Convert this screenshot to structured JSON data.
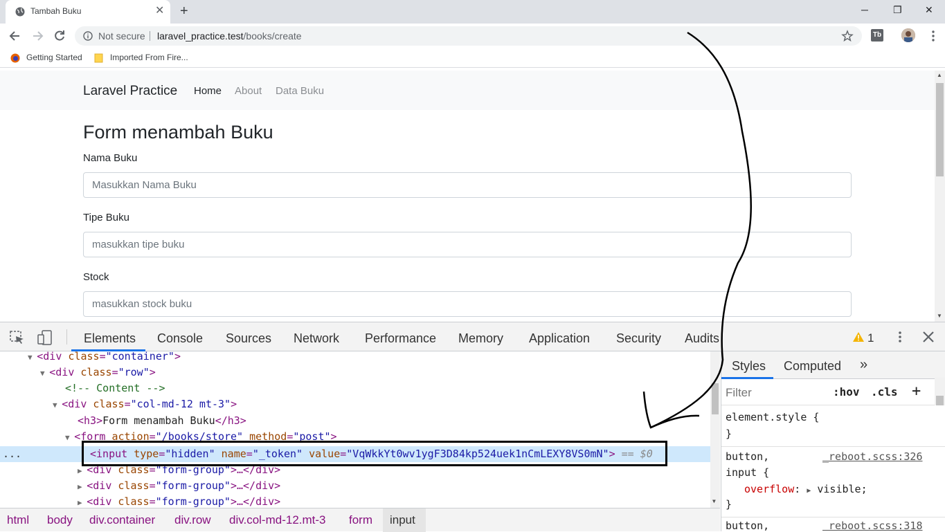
{
  "browser": {
    "tab_title": "Tambah Buku",
    "not_secure_label": "Not secure",
    "url_host": "laravel_practice.test",
    "url_path": "/books/create",
    "bookmarks": [
      {
        "label": "Getting Started"
      },
      {
        "label": "Imported From Fire..."
      }
    ]
  },
  "page": {
    "brand": "Laravel Practice",
    "nav": [
      "Home",
      "About",
      "Data Buku"
    ],
    "title": "Form menambah Buku",
    "fields": [
      {
        "label": "Nama Buku",
        "placeholder": "Masukkan Nama Buku",
        "value": ""
      },
      {
        "label": "Tipe Buku",
        "placeholder": "masukkan tipe buku",
        "value": ""
      },
      {
        "label": "Stock",
        "placeholder": "masukkan stock buku",
        "value": ""
      }
    ]
  },
  "devtools": {
    "tabs": [
      "Elements",
      "Console",
      "Sources",
      "Network",
      "Performance",
      "Memory",
      "Application",
      "Security",
      "Audits"
    ],
    "active_tab": "Elements",
    "warning_count": "1",
    "dom": {
      "l1_tag": "<div",
      "l1_attr": "class",
      "l1_val": "\"container\"",
      "l1_end": ">",
      "l2_tag": "<div",
      "l2_attr": "class",
      "l2_val": "\"row\"",
      "l2_end": ">",
      "l3_comment": "<!-- Content -->",
      "l4_tag": "<div",
      "l4_attr": "class",
      "l4_val": "\"col-md-12 mt-3\"",
      "l4_end": ">",
      "l5_open": "<h3>",
      "l5_text": "Form menambah Buku",
      "l5_close": "</h3>",
      "l6_tag": "<form",
      "l6_attr1": "action",
      "l6_val1": "\"/books/store\"",
      "l6_attr2": "method",
      "l6_val2": "\"post\"",
      "l6_end": ">",
      "l7_tag": "<input",
      "l7_attr1": "type",
      "l7_val1": "\"hidden\"",
      "l7_attr2": "name",
      "l7_val2": "\"_token\"",
      "l7_attr3": "value",
      "l7_val3": "\"VqWkkYt0wv1ygF3D84kp524uek1nCmLEXY8VS0mN\"",
      "l7_end": ">",
      "l7_ref": " == $0",
      "fg_tag": "<div",
      "fg_attr": "class",
      "fg_val": "\"form-group\"",
      "fg_end": ">…</div>",
      "ellipsis": "..."
    },
    "breadcrumbs": [
      "html",
      "body",
      "div.container",
      "div.row",
      "div.col-md-12.mt-3",
      "form",
      "input"
    ],
    "styles": {
      "tabs": [
        "Styles",
        "Computed"
      ],
      "more": "»",
      "filter_placeholder": "Filter",
      "hov": ":hov",
      "cls": ".cls",
      "plus": "+",
      "element_style": "element.style {",
      "close_brace": "}",
      "rule1_selector_a": "button,",
      "rule1_source": "_reboot.scss:326",
      "rule1_selector_b": "input {",
      "rule1_prop": "overflow",
      "rule1_value": "visible;",
      "rule2_selector": "button,",
      "rule2_source": "_reboot.scss:318"
    }
  },
  "colors": {
    "accent": "#1a73e8",
    "selected_row": "#cfe8fc",
    "navbar_bg": "#f8f9fa"
  }
}
